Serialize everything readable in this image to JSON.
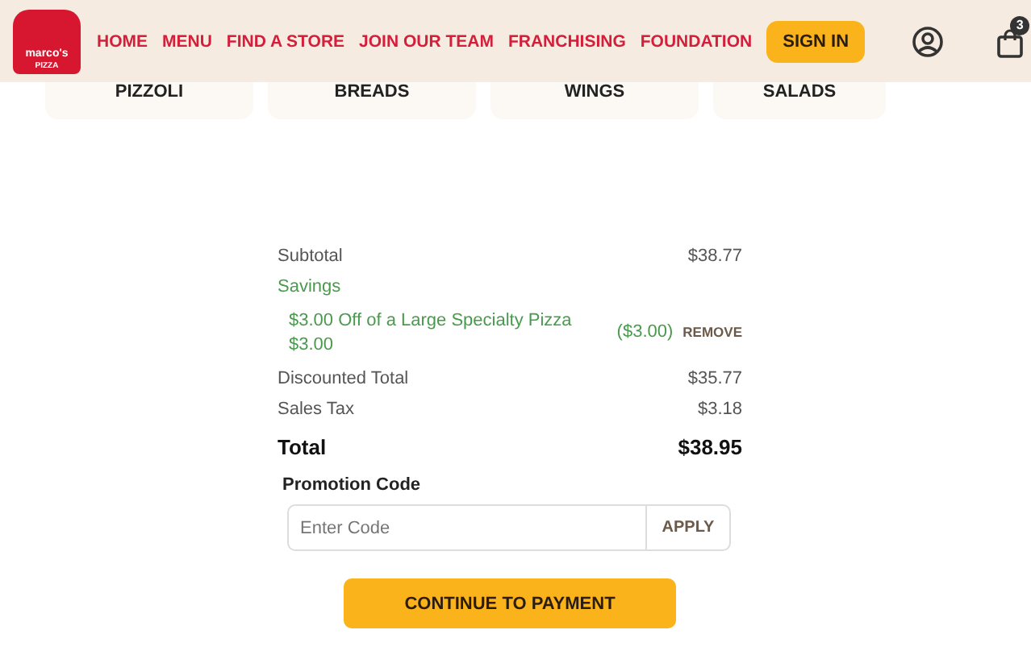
{
  "logo": {
    "name": "marco's",
    "sub": "PIZZA"
  },
  "nav": [
    "HOME",
    "MENU",
    "FIND A STORE",
    "JOIN OUR TEAM",
    "FRANCHISING",
    "FOUNDATION"
  ],
  "sign_in": "SIGN IN",
  "cart": {
    "count": "3"
  },
  "categories": [
    "PIZZOLI",
    "BREADS",
    "WINGS",
    "SALADS"
  ],
  "summary": [
    {
      "kind": "line",
      "label": "Subtotal",
      "amount": "$38.77"
    },
    {
      "kind": "heading",
      "label": "Savings"
    },
    {
      "kind": "discount",
      "label": "$3.00 Off of a Large Specialty Pizza",
      "sub": "$3.00",
      "amount": "($3.00)",
      "action": "REMOVE"
    },
    {
      "kind": "line",
      "label": "Discounted Total",
      "amount": "$35.77"
    },
    {
      "kind": "line",
      "label": "Sales Tax",
      "amount": "$3.18"
    },
    {
      "kind": "total",
      "label": "Total",
      "amount": "$38.95"
    }
  ],
  "promo": {
    "label": "Promotion Code",
    "placeholder": "Enter Code",
    "button": "APPLY"
  },
  "continue": "CONTINUE TO PAYMENT"
}
